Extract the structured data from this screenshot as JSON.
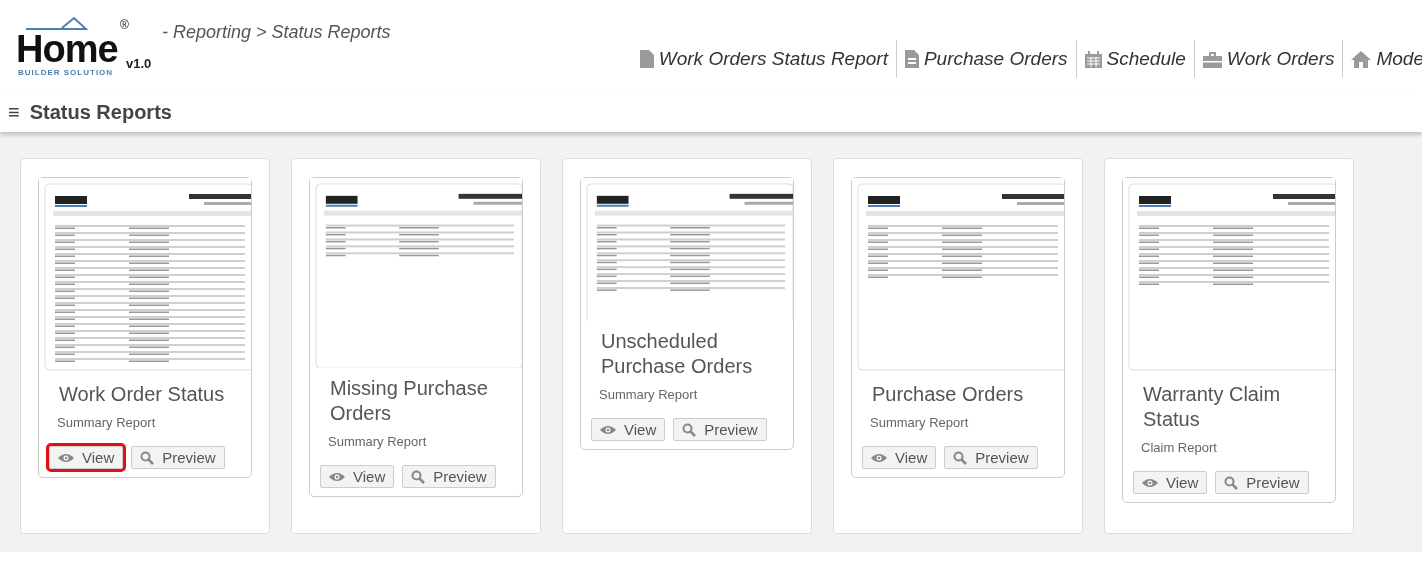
{
  "header": {
    "logo": {
      "word": "Home",
      "tagline": "BUILDER SOLUTION",
      "mark": "®",
      "version": "v1.0"
    },
    "breadcrumb": "- Reporting > Status Reports",
    "nav": [
      {
        "label": "Work Orders Status Report"
      },
      {
        "label": "Purchase Orders"
      },
      {
        "label": "Schedule"
      },
      {
        "label": "Work Orders"
      },
      {
        "label": "Mode"
      }
    ]
  },
  "page_title": {
    "menu_icon": "≡",
    "text": "Status Reports"
  },
  "reports": [
    {
      "title": "Work Order Status",
      "subtitle": "Summary Report",
      "buttons": [
        {
          "label": "View",
          "highlighted": true
        },
        {
          "label": "Preview",
          "highlighted": false
        }
      ]
    },
    {
      "title": "Missing Purchase Orders",
      "subtitle": "Summary Report",
      "buttons": [
        {
          "label": "View",
          "highlighted": false
        },
        {
          "label": "Preview",
          "highlighted": false
        }
      ]
    },
    {
      "title": "Unscheduled Purchase Orders",
      "subtitle": "Summary Report",
      "buttons": [
        {
          "label": "View",
          "highlighted": false
        },
        {
          "label": "Preview",
          "highlighted": false
        }
      ]
    },
    {
      "title": "Purchase Orders",
      "subtitle": "Summary Report",
      "buttons": [
        {
          "label": "View",
          "highlighted": false
        },
        {
          "label": "Preview",
          "highlighted": false
        }
      ]
    },
    {
      "title": "Warranty Claim Status",
      "subtitle": "Claim Report",
      "buttons": [
        {
          "label": "View",
          "highlighted": false
        },
        {
          "label": "Preview",
          "highlighted": false
        }
      ]
    }
  ]
}
